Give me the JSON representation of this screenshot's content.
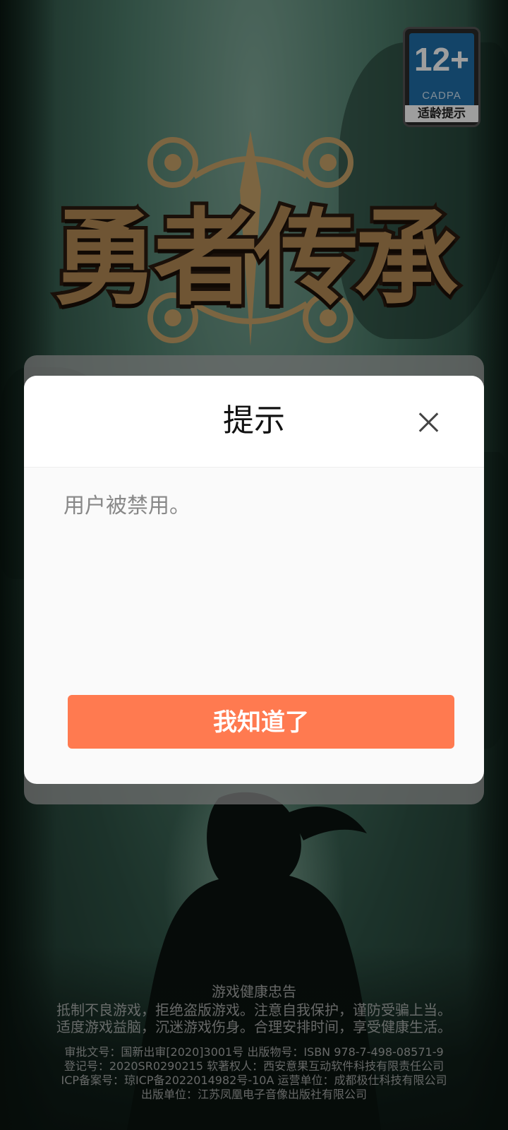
{
  "age_rating": {
    "age": "12+",
    "org": "CADPA",
    "label": "适龄提示"
  },
  "game": {
    "title": "勇者传承"
  },
  "dialog": {
    "title": "提示",
    "close_icon": "close-icon",
    "message": "用户被禁用。",
    "confirm_label": "我知道了",
    "confirm_color": "#ff7a50"
  },
  "footer": {
    "advice_title": "游戏健康忠告",
    "advice_lines": [
      "抵制不良游戏，拒绝盗版游戏。注意自我保护，谨防受骗上当。",
      "适度游戏益脑，沉迷游戏伤身。合理安排时间，享受健康生活。"
    ],
    "legal_lines": [
      "审批文号：国新出审[2020]3001号 出版物号：ISBN 978-7-498-08571-9",
      "登记号：2020SR0290215 软著权人：西安意果互动软件科技有限责任公司",
      "ICP备案号：琼ICP备2022014982号-10A 运营单位：成都极仕科技有限公司",
      "出版单位：江苏凤凰电子音像出版社有限公司"
    ]
  }
}
